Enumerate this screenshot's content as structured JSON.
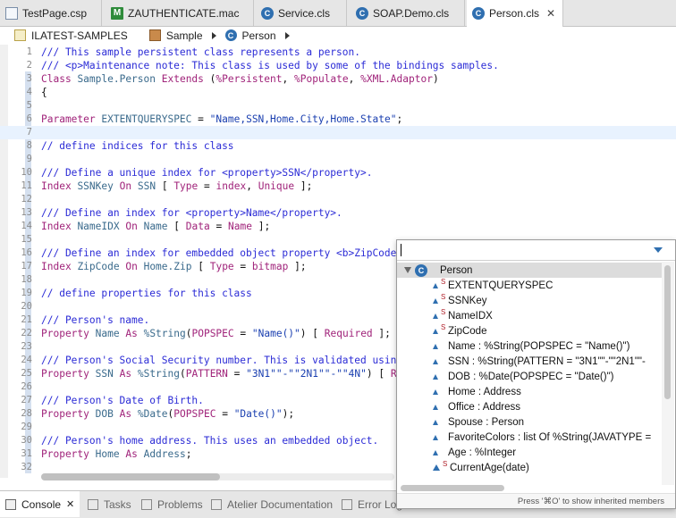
{
  "tabs": [
    {
      "label": "TestPage.csp",
      "icon": "csp-file-icon"
    },
    {
      "label": "ZAUTHENTICATE.mac",
      "icon": "mac-routine-icon"
    },
    {
      "label": "Service.cls",
      "icon": "class-file-icon"
    },
    {
      "label": "SOAP.Demo.cls",
      "icon": "class-file-icon"
    },
    {
      "label": "Person.cls",
      "icon": "class-file-icon",
      "close": "✕"
    }
  ],
  "breadcrumb": {
    "project": "ILATEST-SAMPLES",
    "package": "Sample",
    "class": "Person",
    "class_icon_letter": "C",
    "mac_icon_letter": "M"
  },
  "editor": {
    "lines": [
      {
        "n": "1",
        "text": "/// This sample persistent class represents a person."
      },
      {
        "n": "2",
        "text": "/// <p>Maintenance note: This class is used by some of the bindings samples."
      },
      {
        "n": "3",
        "text": "Class Sample.Person Extends (%Persistent, %Populate, %XML.Adaptor)"
      },
      {
        "n": "4",
        "text": "{"
      },
      {
        "n": "5",
        "text": ""
      },
      {
        "n": "6",
        "text": "Parameter EXTENTQUERYSPEC = \"Name,SSN,Home.City,Home.State\";"
      },
      {
        "n": "7",
        "text": ""
      },
      {
        "n": "8",
        "text": "// define indices for this class"
      },
      {
        "n": "9",
        "text": ""
      },
      {
        "n": "10",
        "text": "/// Define a unique index for <property>SSN</property>."
      },
      {
        "n": "11",
        "text": "Index SSNKey On SSN [ Type = index, Unique ];"
      },
      {
        "n": "12",
        "text": ""
      },
      {
        "n": "13",
        "text": "/// Define an index for <property>Name</property>."
      },
      {
        "n": "14",
        "text": "Index NameIDX On Name [ Data = Name ];"
      },
      {
        "n": "15",
        "text": ""
      },
      {
        "n": "16",
        "text": "/// Define an index for embedded object property <b>ZipCode</b>"
      },
      {
        "n": "17",
        "text": "Index ZipCode On Home.Zip [ Type = bitmap ];"
      },
      {
        "n": "18",
        "text": ""
      },
      {
        "n": "19",
        "text": "// define properties for this class"
      },
      {
        "n": "20",
        "text": ""
      },
      {
        "n": "21",
        "text": "/// Person's name."
      },
      {
        "n": "22",
        "text": "Property Name As %String(POPSPEC = \"Name()\") [ Required ];"
      },
      {
        "n": "23",
        "text": ""
      },
      {
        "n": "24",
        "text": "/// Person's Social Security number. This is validated using"
      },
      {
        "n": "25",
        "text": "Property SSN As %String(PATTERN = \"3N1\"\"-\"\"2N1\"\"-\"\"4N\") [ Re"
      },
      {
        "n": "26",
        "text": ""
      },
      {
        "n": "27",
        "text": "/// Person's Date of Birth."
      },
      {
        "n": "28",
        "text": "Property DOB As %Date(POPSPEC = \"Date()\");"
      },
      {
        "n": "29",
        "text": ""
      },
      {
        "n": "30",
        "text": "/// Person's home address. This uses an embedded object."
      },
      {
        "n": "31",
        "text": "Property Home As Address;"
      },
      {
        "n": "32",
        "text": ""
      }
    ]
  },
  "popup": {
    "root": "Person",
    "root_icon_letter": "C",
    "sup_marker": "S",
    "items": [
      {
        "label": "EXTENTQUERYSPEC",
        "static": true
      },
      {
        "label": "SSNKey",
        "static": true
      },
      {
        "label": "NameIDX",
        "static": true
      },
      {
        "label": "ZipCode",
        "static": true
      },
      {
        "label": "Name : %String(POPSPEC = \"Name()\")",
        "static": false
      },
      {
        "label": "SSN : %String(PATTERN = \"3N1\"\"-\"\"2N1\"\"-",
        "static": false
      },
      {
        "label": "DOB : %Date(POPSPEC = \"Date()\")",
        "static": false
      },
      {
        "label": "Home : Address",
        "static": false
      },
      {
        "label": "Office : Address",
        "static": false
      },
      {
        "label": "Spouse : Person",
        "static": false
      },
      {
        "label": "FavoriteColors : list Of %String(JAVATYPE =",
        "static": false
      },
      {
        "label": "Age : %Integer",
        "static": false
      },
      {
        "label": "CurrentAge(date)",
        "static": true,
        "method": true
      }
    ],
    "footer": "Press '⌘O' to show inherited members"
  },
  "bottom_tabs": [
    {
      "label": "Console",
      "icon": "console-icon",
      "close": "✕",
      "active": true
    },
    {
      "label": "Tasks",
      "icon": "tasks-icon"
    },
    {
      "label": "Problems",
      "icon": "problems-icon"
    },
    {
      "label": "Atelier Documentation",
      "icon": "documentation-icon"
    },
    {
      "label": "Error Log",
      "icon": "error-log-icon"
    }
  ],
  "colors": {
    "comment": "#2b2bd6",
    "keyword": "#a0237a",
    "identifier": "#3a6a8c",
    "class_icon": "#2f6fb0",
    "mac_icon": "#2e8b3a"
  }
}
